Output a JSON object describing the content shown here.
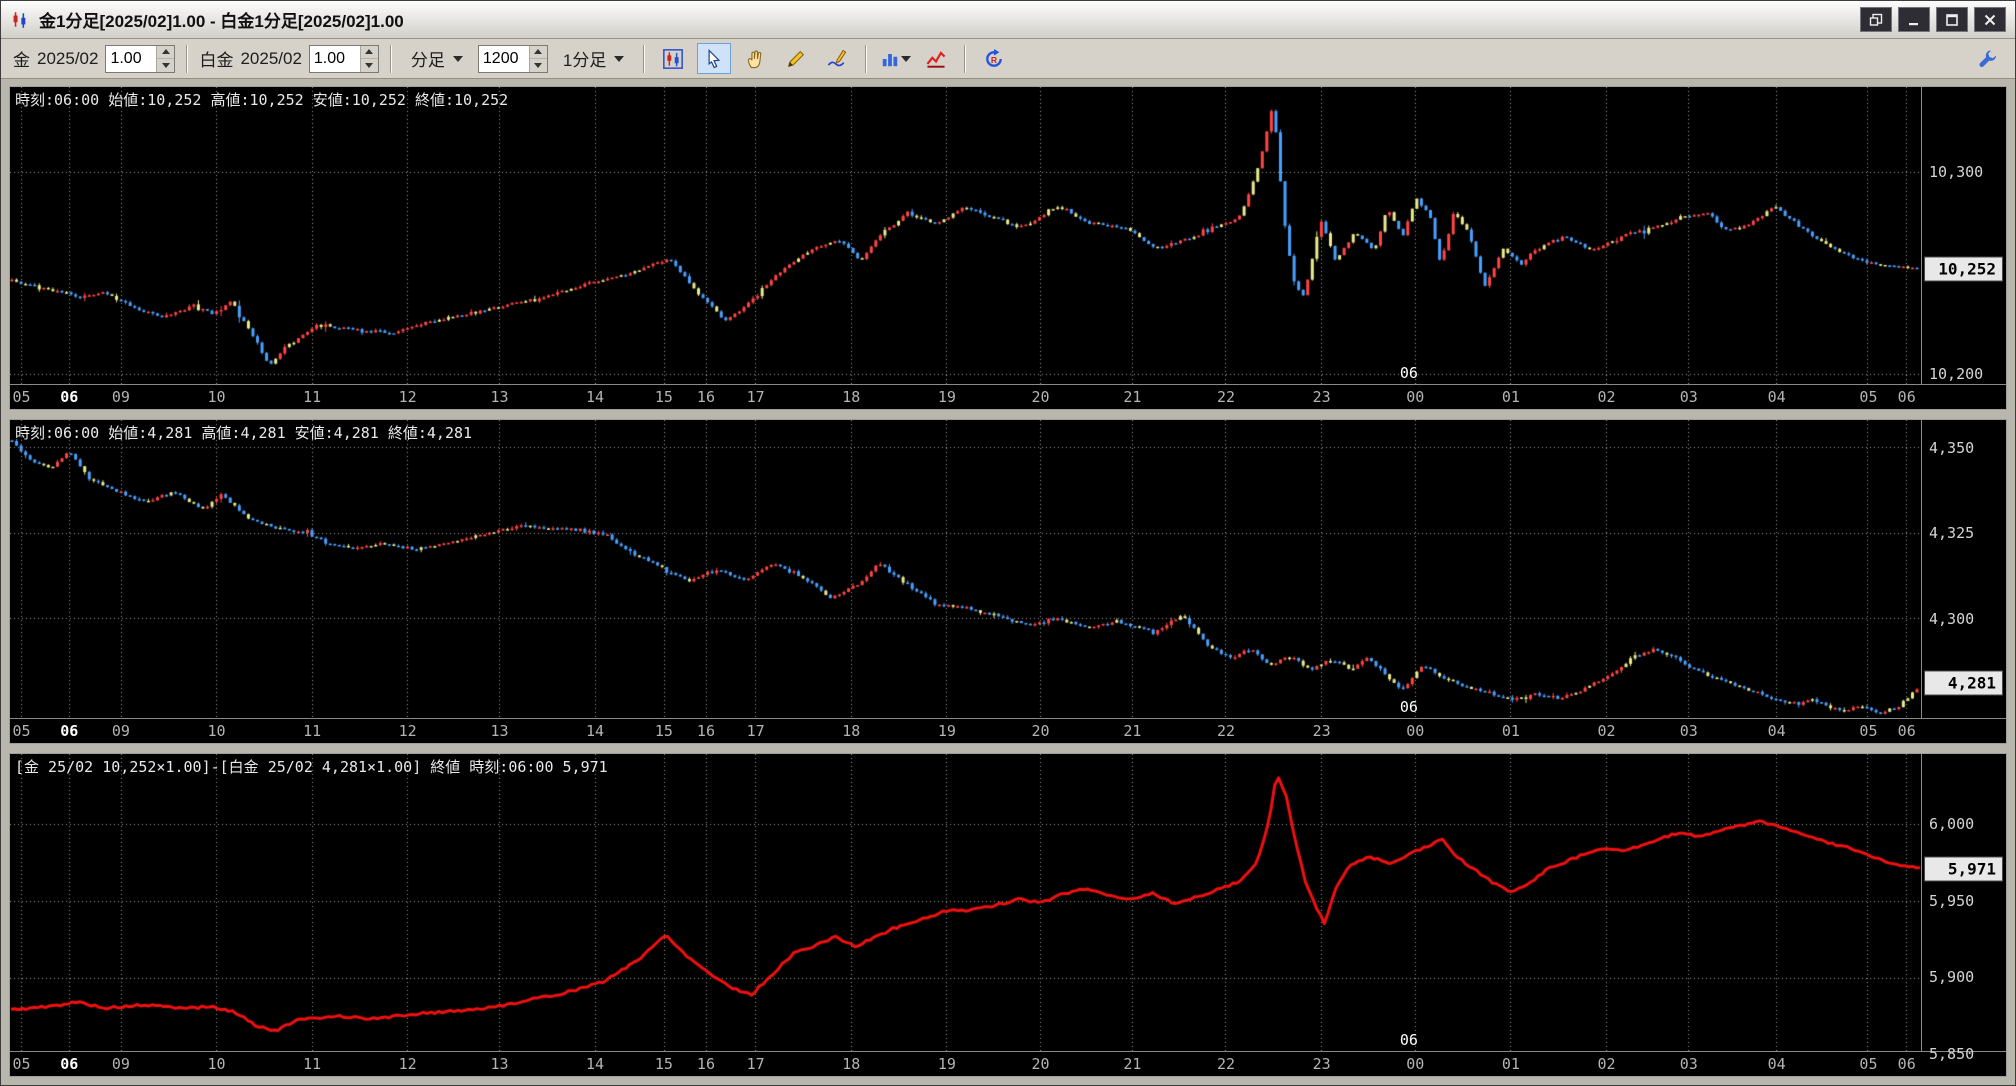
{
  "window": {
    "title": "金1分足[2025/02]1.00 - 白金1分足[2025/02]1.00"
  },
  "toolbar": {
    "gold_label": "金",
    "gold_month": "2025/02",
    "gold_multiplier": "1.00",
    "platinum_label": "白金",
    "platinum_month": "2025/02",
    "platinum_multiplier": "1.00",
    "bar_type": "分足",
    "bar_count": "1200",
    "timeframe": "1分足"
  },
  "icons": [
    "app-icon",
    "detach-window-icon",
    "minimize-icon",
    "maximize-icon",
    "close-icon",
    "kline-chart-icon",
    "cursor-icon",
    "hand-icon",
    "pencil-icon",
    "pen-line-icon",
    "bar-chart-icon",
    "red-line-chart-icon",
    "refresh-icon",
    "wrench-icon"
  ],
  "colors": {
    "up": "#ff4545",
    "down": "#49a0ff",
    "flat": "#eaea8e",
    "spread_line": "#ee1111",
    "grid": "#9b9b9b",
    "panel_bg": "#000000",
    "last_box_bg": "#e8e8e8"
  },
  "time_axis": {
    "ticks": [
      {
        "label": "05",
        "frac": 0.006
      },
      {
        "label": "06",
        "frac": 0.031,
        "emph": true
      },
      {
        "label": "09",
        "frac": 0.058
      },
      {
        "label": "10",
        "frac": 0.108
      },
      {
        "label": "11",
        "frac": 0.158
      },
      {
        "label": "12",
        "frac": 0.208
      },
      {
        "label": "13",
        "frac": 0.256
      },
      {
        "label": "14",
        "frac": 0.306
      },
      {
        "label": "15",
        "frac": 0.342
      },
      {
        "label": "16",
        "frac": 0.364
      },
      {
        "label": "17",
        "frac": 0.39
      },
      {
        "label": "18",
        "frac": 0.44
      },
      {
        "label": "19",
        "frac": 0.49
      },
      {
        "label": "20",
        "frac": 0.539
      },
      {
        "label": "21",
        "frac": 0.587
      },
      {
        "label": "22",
        "frac": 0.636
      },
      {
        "label": "23",
        "frac": 0.686
      },
      {
        "label": "00",
        "frac": 0.735
      },
      {
        "label": "01",
        "frac": 0.785
      },
      {
        "label": "02",
        "frac": 0.835
      },
      {
        "label": "03",
        "frac": 0.878
      },
      {
        "label": "04",
        "frac": 0.924
      },
      {
        "label": "05",
        "frac": 0.972
      },
      {
        "label": "06",
        "frac": 0.992
      }
    ],
    "date_label": {
      "label": "06",
      "frac": 0.732
    }
  },
  "chart_data": [
    {
      "id": "gold",
      "type": "candlestick",
      "info_text": "時刻:06:00 始値:10,252 高値:10,252 安値:10,252 終値:10,252",
      "y_min": 10195,
      "y_max": 10342,
      "y_ticks": [
        10300,
        10200
      ],
      "last_price": 10252,
      "last_label": "10,252",
      "bars": 420,
      "seed": 7,
      "anchors": [
        [
          0,
          10246
        ],
        [
          0.02,
          10242
        ],
        [
          0.035,
          10238
        ],
        [
          0.05,
          10240
        ],
        [
          0.065,
          10232
        ],
        [
          0.08,
          10228
        ],
        [
          0.095,
          10234
        ],
        [
          0.105,
          10230
        ],
        [
          0.115,
          10236
        ],
        [
          0.125,
          10222
        ],
        [
          0.135,
          10204
        ],
        [
          0.145,
          10214
        ],
        [
          0.16,
          10224
        ],
        [
          0.18,
          10222
        ],
        [
          0.2,
          10220
        ],
        [
          0.22,
          10226
        ],
        [
          0.24,
          10230
        ],
        [
          0.26,
          10234
        ],
        [
          0.28,
          10238
        ],
        [
          0.3,
          10244
        ],
        [
          0.325,
          10250
        ],
        [
          0.345,
          10257
        ],
        [
          0.36,
          10240
        ],
        [
          0.375,
          10226
        ],
        [
          0.39,
          10238
        ],
        [
          0.405,
          10252
        ],
        [
          0.42,
          10262
        ],
        [
          0.435,
          10266
        ],
        [
          0.445,
          10256
        ],
        [
          0.455,
          10268
        ],
        [
          0.47,
          10280
        ],
        [
          0.485,
          10274
        ],
        [
          0.5,
          10283
        ],
        [
          0.515,
          10278
        ],
        [
          0.53,
          10272
        ],
        [
          0.55,
          10283
        ],
        [
          0.565,
          10275
        ],
        [
          0.585,
          10272
        ],
        [
          0.6,
          10262
        ],
        [
          0.615,
          10266
        ],
        [
          0.63,
          10272
        ],
        [
          0.645,
          10278
        ],
        [
          0.655,
          10305
        ],
        [
          0.662,
          10333
        ],
        [
          0.668,
          10275
        ],
        [
          0.673,
          10245
        ],
        [
          0.678,
          10238
        ],
        [
          0.687,
          10276
        ],
        [
          0.695,
          10256
        ],
        [
          0.705,
          10270
        ],
        [
          0.715,
          10261
        ],
        [
          0.722,
          10282
        ],
        [
          0.73,
          10268
        ],
        [
          0.737,
          10287
        ],
        [
          0.744,
          10280
        ],
        [
          0.75,
          10254
        ],
        [
          0.757,
          10280
        ],
        [
          0.765,
          10270
        ],
        [
          0.773,
          10243
        ],
        [
          0.783,
          10262
        ],
        [
          0.793,
          10254
        ],
        [
          0.8,
          10262
        ],
        [
          0.815,
          10268
        ],
        [
          0.83,
          10261
        ],
        [
          0.845,
          10268
        ],
        [
          0.86,
          10272
        ],
        [
          0.875,
          10277
        ],
        [
          0.89,
          10280
        ],
        [
          0.9,
          10271
        ],
        [
          0.912,
          10274
        ],
        [
          0.925,
          10283
        ],
        [
          0.94,
          10272
        ],
        [
          0.952,
          10264
        ],
        [
          0.965,
          10258
        ],
        [
          0.98,
          10254
        ],
        [
          1,
          10252
        ]
      ]
    },
    {
      "id": "platinum",
      "type": "candlestick",
      "info_text": "時刻:06:00 始値:4,281 高値:4,281 安値:4,281 終値:4,281",
      "y_min": 4271,
      "y_max": 4358,
      "y_ticks": [
        4350,
        4325,
        4300
      ],
      "last_price": 4281,
      "last_label": "4,281",
      "bars": 420,
      "seed": 21,
      "anchors": [
        [
          0,
          4352
        ],
        [
          0.01,
          4346
        ],
        [
          0.02,
          4344
        ],
        [
          0.03,
          4349
        ],
        [
          0.04,
          4341
        ],
        [
          0.055,
          4337
        ],
        [
          0.07,
          4334
        ],
        [
          0.085,
          4337
        ],
        [
          0.1,
          4332
        ],
        [
          0.11,
          4336
        ],
        [
          0.125,
          4329
        ],
        [
          0.14,
          4326
        ],
        [
          0.155,
          4325
        ],
        [
          0.165,
          4322
        ],
        [
          0.18,
          4320
        ],
        [
          0.195,
          4322
        ],
        [
          0.21,
          4320
        ],
        [
          0.23,
          4322
        ],
        [
          0.25,
          4325
        ],
        [
          0.27,
          4327
        ],
        [
          0.29,
          4326
        ],
        [
          0.31,
          4325
        ],
        [
          0.325,
          4319
        ],
        [
          0.34,
          4315
        ],
        [
          0.355,
          4311
        ],
        [
          0.37,
          4314
        ],
        [
          0.385,
          4311
        ],
        [
          0.4,
          4316
        ],
        [
          0.415,
          4312
        ],
        [
          0.43,
          4306
        ],
        [
          0.445,
          4310
        ],
        [
          0.455,
          4316
        ],
        [
          0.47,
          4310
        ],
        [
          0.485,
          4304
        ],
        [
          0.5,
          4303
        ],
        [
          0.52,
          4300
        ],
        [
          0.535,
          4298
        ],
        [
          0.55,
          4300
        ],
        [
          0.565,
          4297
        ],
        [
          0.58,
          4299
        ],
        [
          0.6,
          4296
        ],
        [
          0.615,
          4301
        ],
        [
          0.628,
          4292
        ],
        [
          0.64,
          4288
        ],
        [
          0.65,
          4291
        ],
        [
          0.66,
          4286
        ],
        [
          0.67,
          4289
        ],
        [
          0.682,
          4285
        ],
        [
          0.692,
          4288
        ],
        [
          0.702,
          4285
        ],
        [
          0.712,
          4288
        ],
        [
          0.722,
          4283
        ],
        [
          0.73,
          4279
        ],
        [
          0.74,
          4286
        ],
        [
          0.75,
          4283
        ],
        [
          0.762,
          4280
        ],
        [
          0.775,
          4278
        ],
        [
          0.788,
          4276
        ],
        [
          0.8,
          4278
        ],
        [
          0.812,
          4276
        ],
        [
          0.825,
          4279
        ],
        [
          0.838,
          4283
        ],
        [
          0.85,
          4288
        ],
        [
          0.862,
          4291
        ],
        [
          0.874,
          4288
        ],
        [
          0.886,
          4284
        ],
        [
          0.898,
          4282
        ],
        [
          0.91,
          4279
        ],
        [
          0.922,
          4277
        ],
        [
          0.934,
          4275
        ],
        [
          0.946,
          4276
        ],
        [
          0.958,
          4273
        ],
        [
          0.97,
          4274
        ],
        [
          0.98,
          4272
        ],
        [
          0.99,
          4274
        ],
        [
          1,
          4279
        ]
      ]
    },
    {
      "id": "spread",
      "type": "line",
      "info_text": "[金 25/02 10,252×1.00]-[白金 25/02 4,281×1.00] 終値 時刻:06:00 5,971",
      "y_min": 5852,
      "y_max": 6046,
      "y_ticks": [
        6000,
        5950,
        5900,
        5850
      ],
      "last_price": 5971,
      "last_label": "5,971",
      "seed": 5,
      "anchors": [
        [
          0,
          5879
        ],
        [
          0.02,
          5881
        ],
        [
          0.035,
          5884
        ],
        [
          0.05,
          5880
        ],
        [
          0.07,
          5882
        ],
        [
          0.09,
          5880
        ],
        [
          0.105,
          5881
        ],
        [
          0.118,
          5877
        ],
        [
          0.128,
          5869
        ],
        [
          0.138,
          5865
        ],
        [
          0.15,
          5872
        ],
        [
          0.17,
          5875
        ],
        [
          0.19,
          5873
        ],
        [
          0.21,
          5876
        ],
        [
          0.23,
          5878
        ],
        [
          0.25,
          5880
        ],
        [
          0.27,
          5885
        ],
        [
          0.29,
          5890
        ],
        [
          0.31,
          5897
        ],
        [
          0.33,
          5913
        ],
        [
          0.343,
          5928
        ],
        [
          0.355,
          5913
        ],
        [
          0.368,
          5901
        ],
        [
          0.378,
          5893
        ],
        [
          0.388,
          5889
        ],
        [
          0.398,
          5901
        ],
        [
          0.41,
          5916
        ],
        [
          0.422,
          5921
        ],
        [
          0.432,
          5927
        ],
        [
          0.442,
          5920
        ],
        [
          0.452,
          5926
        ],
        [
          0.462,
          5932
        ],
        [
          0.475,
          5937
        ],
        [
          0.488,
          5943
        ],
        [
          0.5,
          5944
        ],
        [
          0.515,
          5947
        ],
        [
          0.528,
          5951
        ],
        [
          0.54,
          5949
        ],
        [
          0.552,
          5955
        ],
        [
          0.563,
          5958
        ],
        [
          0.575,
          5954
        ],
        [
          0.586,
          5951
        ],
        [
          0.598,
          5955
        ],
        [
          0.61,
          5948
        ],
        [
          0.622,
          5953
        ],
        [
          0.633,
          5958
        ],
        [
          0.644,
          5963
        ],
        [
          0.653,
          5976
        ],
        [
          0.659,
          6002
        ],
        [
          0.663,
          6034
        ],
        [
          0.668,
          6018
        ],
        [
          0.673,
          5988
        ],
        [
          0.678,
          5963
        ],
        [
          0.683,
          5948
        ],
        [
          0.688,
          5936
        ],
        [
          0.695,
          5961
        ],
        [
          0.702,
          5974
        ],
        [
          0.712,
          5979
        ],
        [
          0.722,
          5974
        ],
        [
          0.732,
          5980
        ],
        [
          0.742,
          5986
        ],
        [
          0.75,
          5990
        ],
        [
          0.757,
          5979
        ],
        [
          0.765,
          5972
        ],
        [
          0.775,
          5963
        ],
        [
          0.785,
          5956
        ],
        [
          0.795,
          5961
        ],
        [
          0.805,
          5971
        ],
        [
          0.815,
          5976
        ],
        [
          0.825,
          5981
        ],
        [
          0.835,
          5985
        ],
        [
          0.845,
          5983
        ],
        [
          0.855,
          5986
        ],
        [
          0.865,
          5991
        ],
        [
          0.875,
          5995
        ],
        [
          0.885,
          5992
        ],
        [
          0.895,
          5996
        ],
        [
          0.905,
          5999
        ],
        [
          0.915,
          6002
        ],
        [
          0.925,
          5999
        ],
        [
          0.935,
          5995
        ],
        [
          0.945,
          5991
        ],
        [
          0.955,
          5987
        ],
        [
          0.965,
          5984
        ],
        [
          0.975,
          5979
        ],
        [
          0.985,
          5974
        ],
        [
          1,
          5971
        ]
      ]
    }
  ]
}
